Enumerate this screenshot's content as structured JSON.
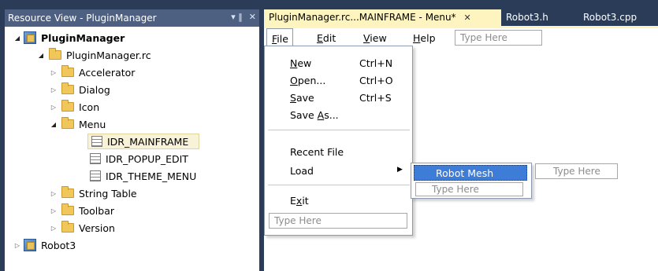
{
  "resource_view": {
    "title": "Resource View - PluginManager",
    "pin_glyph": "▾ ‖",
    "close_glyph": "✕",
    "tree": [
      {
        "label": "PluginManager",
        "bold": true,
        "toggle": "◢",
        "icon": "project"
      },
      {
        "label": "PluginManager.rc",
        "toggle": "◢",
        "icon": "folder"
      },
      {
        "label": "Accelerator",
        "toggle": "▷",
        "icon": "folder"
      },
      {
        "label": "Dialog",
        "toggle": "▷",
        "icon": "folder"
      },
      {
        "label": "Icon",
        "toggle": "▷",
        "icon": "folder"
      },
      {
        "label": "Menu",
        "toggle": "◢",
        "icon": "folder"
      },
      {
        "label": "IDR_MAINFRAME",
        "selected": true,
        "icon": "menu-resource"
      },
      {
        "label": "IDR_POPUP_EDIT",
        "icon": "menu-resource"
      },
      {
        "label": "IDR_THEME_MENU",
        "icon": "menu-resource"
      },
      {
        "label": "String Table",
        "toggle": "▷",
        "icon": "folder"
      },
      {
        "label": "Toolbar",
        "toggle": "▷",
        "icon": "folder"
      },
      {
        "label": "Version",
        "toggle": "▷",
        "icon": "folder"
      },
      {
        "label": "Robot3",
        "toggle": "▷",
        "icon": "project"
      }
    ]
  },
  "tabs": [
    {
      "label": "PluginManager.rc...MAINFRAME - Menu*",
      "active": true,
      "close": "✕"
    },
    {
      "label": "Robot3.h"
    },
    {
      "label": "Robot3.cpp"
    }
  ],
  "menubar": {
    "items": [
      {
        "label": "File",
        "u": "F",
        "rest": "ile"
      },
      {
        "label": "Edit",
        "u": "E",
        "rest": "dit"
      },
      {
        "label": "View",
        "u": "V",
        "rest": "iew"
      },
      {
        "label": "Help",
        "u": "H",
        "rest": "elp"
      }
    ],
    "type_here": "Type Here"
  },
  "file_menu": {
    "new": {
      "u": "N",
      "rest": "ew",
      "shortcut": "Ctrl+N"
    },
    "open": {
      "u": "O",
      "rest": "pen...",
      "shortcut": "Ctrl+O"
    },
    "save": {
      "u": "S",
      "rest": "ave",
      "shortcut": "Ctrl+S"
    },
    "save_as": {
      "pre": "Save ",
      "u": "A",
      "rest": "s..."
    },
    "recent": "Recent File",
    "load": "Load",
    "load_arrow": "▶",
    "exit": {
      "pre": "E",
      "u": "x",
      "rest": "it"
    },
    "type_here": "Type Here"
  },
  "load_submenu": {
    "highlighted": "Robot Mesh",
    "type_here_right": "Type Here",
    "type_here_below": "Type Here"
  },
  "colors": {
    "background": "#2b3c59",
    "pane_title": "#4d6082",
    "active_tab": "#fdf4bf",
    "highlight": "#3d7dd8"
  }
}
